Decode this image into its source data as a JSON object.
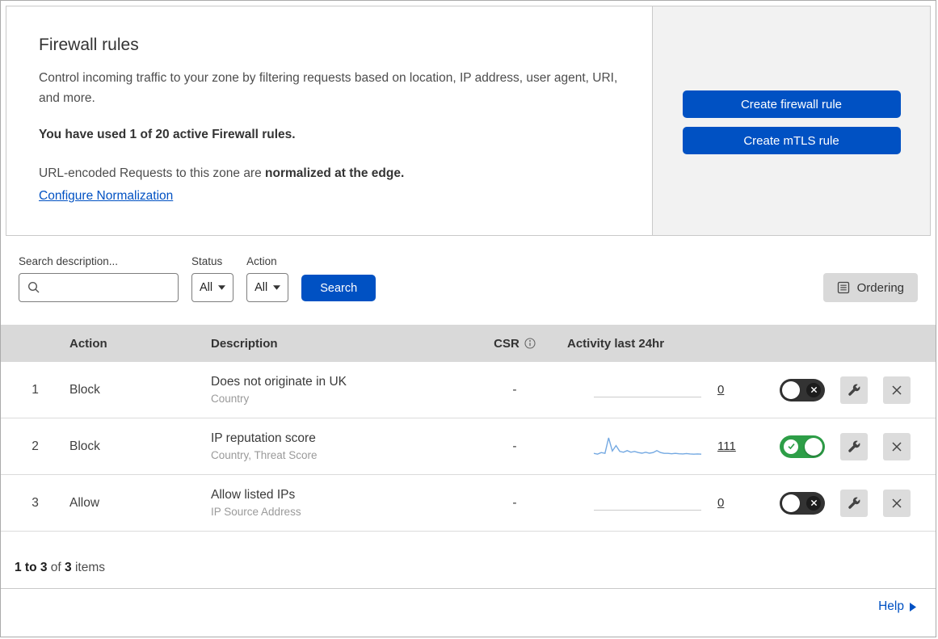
{
  "intro": {
    "title": "Firewall rules",
    "description": "Control incoming traffic to your zone by filtering requests based on location, IP address, user agent, URI, and more.",
    "usage": "You have used 1 of 20 active Firewall rules.",
    "normalization_text": "URL-encoded Requests to this zone are ",
    "normalization_bold": "normalized at the edge.",
    "normalization_link": "Configure Normalization"
  },
  "actions": {
    "create_firewall_rule": "Create firewall rule",
    "create_mtls_rule": "Create mTLS rule"
  },
  "filters": {
    "search_label": "Search description...",
    "status_label": "Status",
    "status_value": "All",
    "action_label": "Action",
    "action_value": "All",
    "search_button": "Search",
    "ordering_button": "Ordering"
  },
  "table": {
    "headers": {
      "action": "Action",
      "description": "Description",
      "csr": "CSR",
      "activity": "Activity last 24hr"
    },
    "rows": [
      {
        "index": "1",
        "action": "Block",
        "description": "Does not originate in UK",
        "criteria": "Country",
        "csr": "-",
        "activity": "0",
        "enabled": false
      },
      {
        "index": "2",
        "action": "Block",
        "description": "IP reputation score",
        "criteria": "Country, Threat Score",
        "csr": "-",
        "activity": "111",
        "enabled": true,
        "sparkline": [
          2,
          1.6,
          2.4,
          2,
          10,
          3.2,
          6,
          3,
          2.6,
          3.4,
          2.6,
          3,
          2.4,
          2.1,
          2.6,
          2.1,
          2.4,
          3.4,
          2.4,
          2,
          2,
          1.8,
          2,
          1.8,
          1.7,
          1.9,
          1.7,
          1.6,
          1.7,
          1.6
        ]
      },
      {
        "index": "3",
        "action": "Allow",
        "description": "Allow listed IPs",
        "criteria": "IP Source Address",
        "csr": "-",
        "activity": "0",
        "enabled": false
      }
    ],
    "footer": {
      "range": "1 to 3",
      "of": " of ",
      "total": "3",
      "items": " items"
    }
  },
  "help": {
    "label": "Help"
  },
  "colors": {
    "accent": "#0051c3",
    "toggle_on": "#2d9e47",
    "toggle_off": "#333333",
    "sparkline": "#74a9e2",
    "header_bg": "#d9d9d9",
    "panel_bg": "#f2f2f2"
  }
}
